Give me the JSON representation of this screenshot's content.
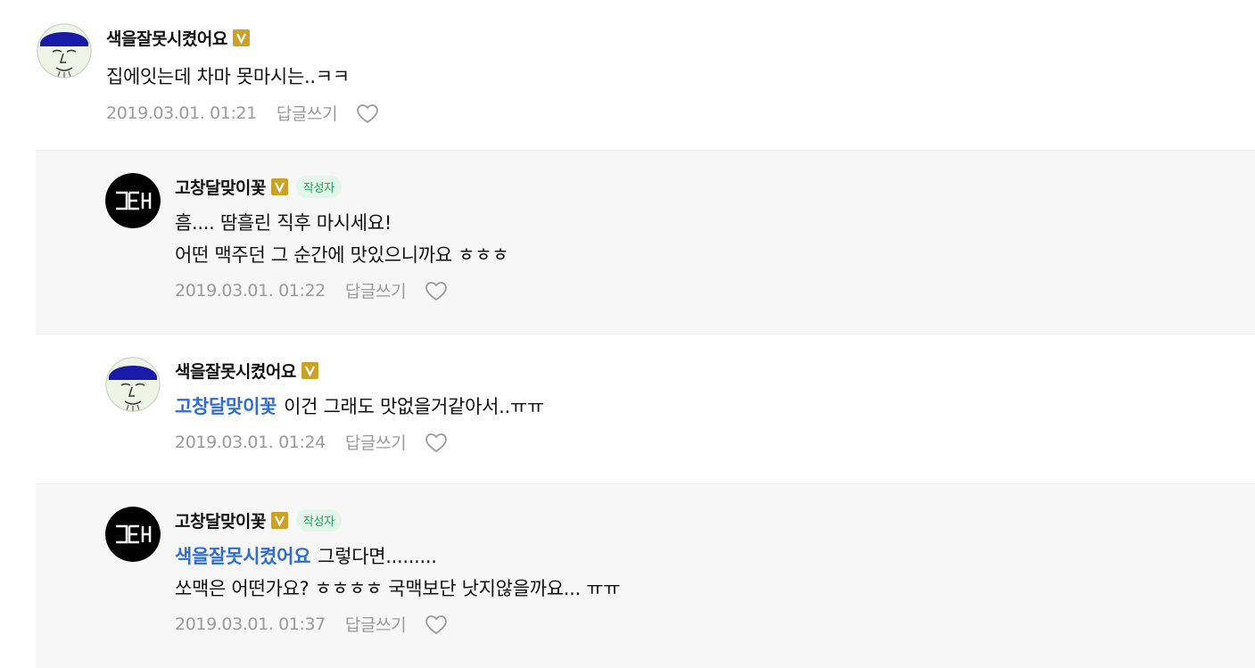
{
  "comments": [
    {
      "name": "색을잘못시켰어요",
      "author_tag": "",
      "mention": "",
      "lines": [
        "집에잇는데 차마 못마시는..ㅋㅋ"
      ],
      "timestamp": "2019.03.01. 01:21",
      "reply_label": "답글쓰기",
      "avatar": "face-avatar"
    },
    {
      "name": "고창달맞이꽃",
      "author_tag": "작성자",
      "mention": "",
      "lines": [
        "흠.... 땀흘린 직후 마시세요!",
        "어떤 맥주던 그 순간에 맛있으니까요 ㅎㅎㅎ"
      ],
      "timestamp": "2019.03.01. 01:22",
      "reply_label": "답글쓰기",
      "avatar": "logo-avatar"
    },
    {
      "name": "색을잘못시켰어요",
      "author_tag": "",
      "mention": "고창달맞이꽃",
      "lines": [
        "이건 그래도 맛없을거같아서..ㅠㅠ"
      ],
      "timestamp": "2019.03.01. 01:24",
      "reply_label": "답글쓰기",
      "avatar": "face-avatar"
    },
    {
      "name": "고창달맞이꽃",
      "author_tag": "작성자",
      "mention": "색을잘못시켰어요",
      "lines": [
        "그렇다면.........",
        "쏘맥은 어떤가요? ㅎㅎㅎㅎ 국맥보단 낫지않을까요... ㅠㅠ"
      ],
      "timestamp": "2019.03.01. 01:37",
      "reply_label": "답글쓰기",
      "avatar": "logo-avatar"
    }
  ],
  "colors": {
    "mention": "#2f6cd3",
    "badge": "#c9a227",
    "author_tag_bg": "#e3f6ea",
    "author_tag_text": "#1fa35a",
    "meta": "#9a9a9a",
    "reply_bg": "#f7f7f7"
  }
}
